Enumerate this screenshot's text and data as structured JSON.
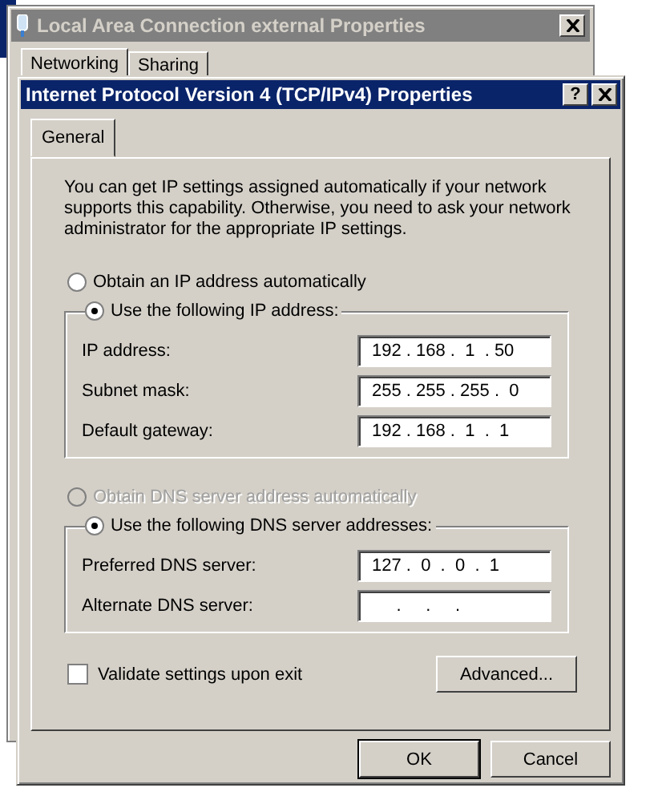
{
  "back_window": {
    "title": "Local Area Connection external Properties",
    "tabs": [
      {
        "label": "Networking",
        "selected": true
      },
      {
        "label": "Sharing",
        "selected": false
      }
    ]
  },
  "window": {
    "title": "Internet Protocol Version 4 (TCP/IPv4) Properties",
    "help_button": "?"
  },
  "tabs": [
    {
      "label": "General",
      "selected": true
    }
  ],
  "intro": "You can get IP settings assigned automatically if your network supports this capability. Otherwise, you need to ask your network administrator for the appropriate IP settings.",
  "ip_section": {
    "auto_option": {
      "label": "Obtain an IP address automatically",
      "selected": false,
      "disabled": false
    },
    "manual_option": {
      "label": "Use the following IP address:",
      "selected": true,
      "disabled": false
    },
    "fields": [
      {
        "label": "IP address:",
        "value": "192 . 168 .  1  . 50"
      },
      {
        "label": "Subnet mask:",
        "value": "255 . 255 . 255 .  0"
      },
      {
        "label": "Default gateway:",
        "value": "192 . 168 .  1  .  1"
      }
    ]
  },
  "dns_section": {
    "auto_option": {
      "label": "Obtain DNS server address automatically",
      "selected": false,
      "disabled": true
    },
    "manual_option": {
      "label": "Use the following DNS server addresses:",
      "selected": true,
      "disabled": false
    },
    "fields": [
      {
        "label": "Preferred DNS server:",
        "value": "127 .  0  .  0  .  1"
      },
      {
        "label": "Alternate DNS server:",
        "value": "     .     .     ."
      }
    ]
  },
  "validate_checkbox": {
    "label": "Validate settings upon exit",
    "checked": false
  },
  "advanced_button": "Advanced...",
  "buttons": [
    {
      "label": "OK",
      "default": true
    },
    {
      "label": "Cancel",
      "default": false
    }
  ]
}
